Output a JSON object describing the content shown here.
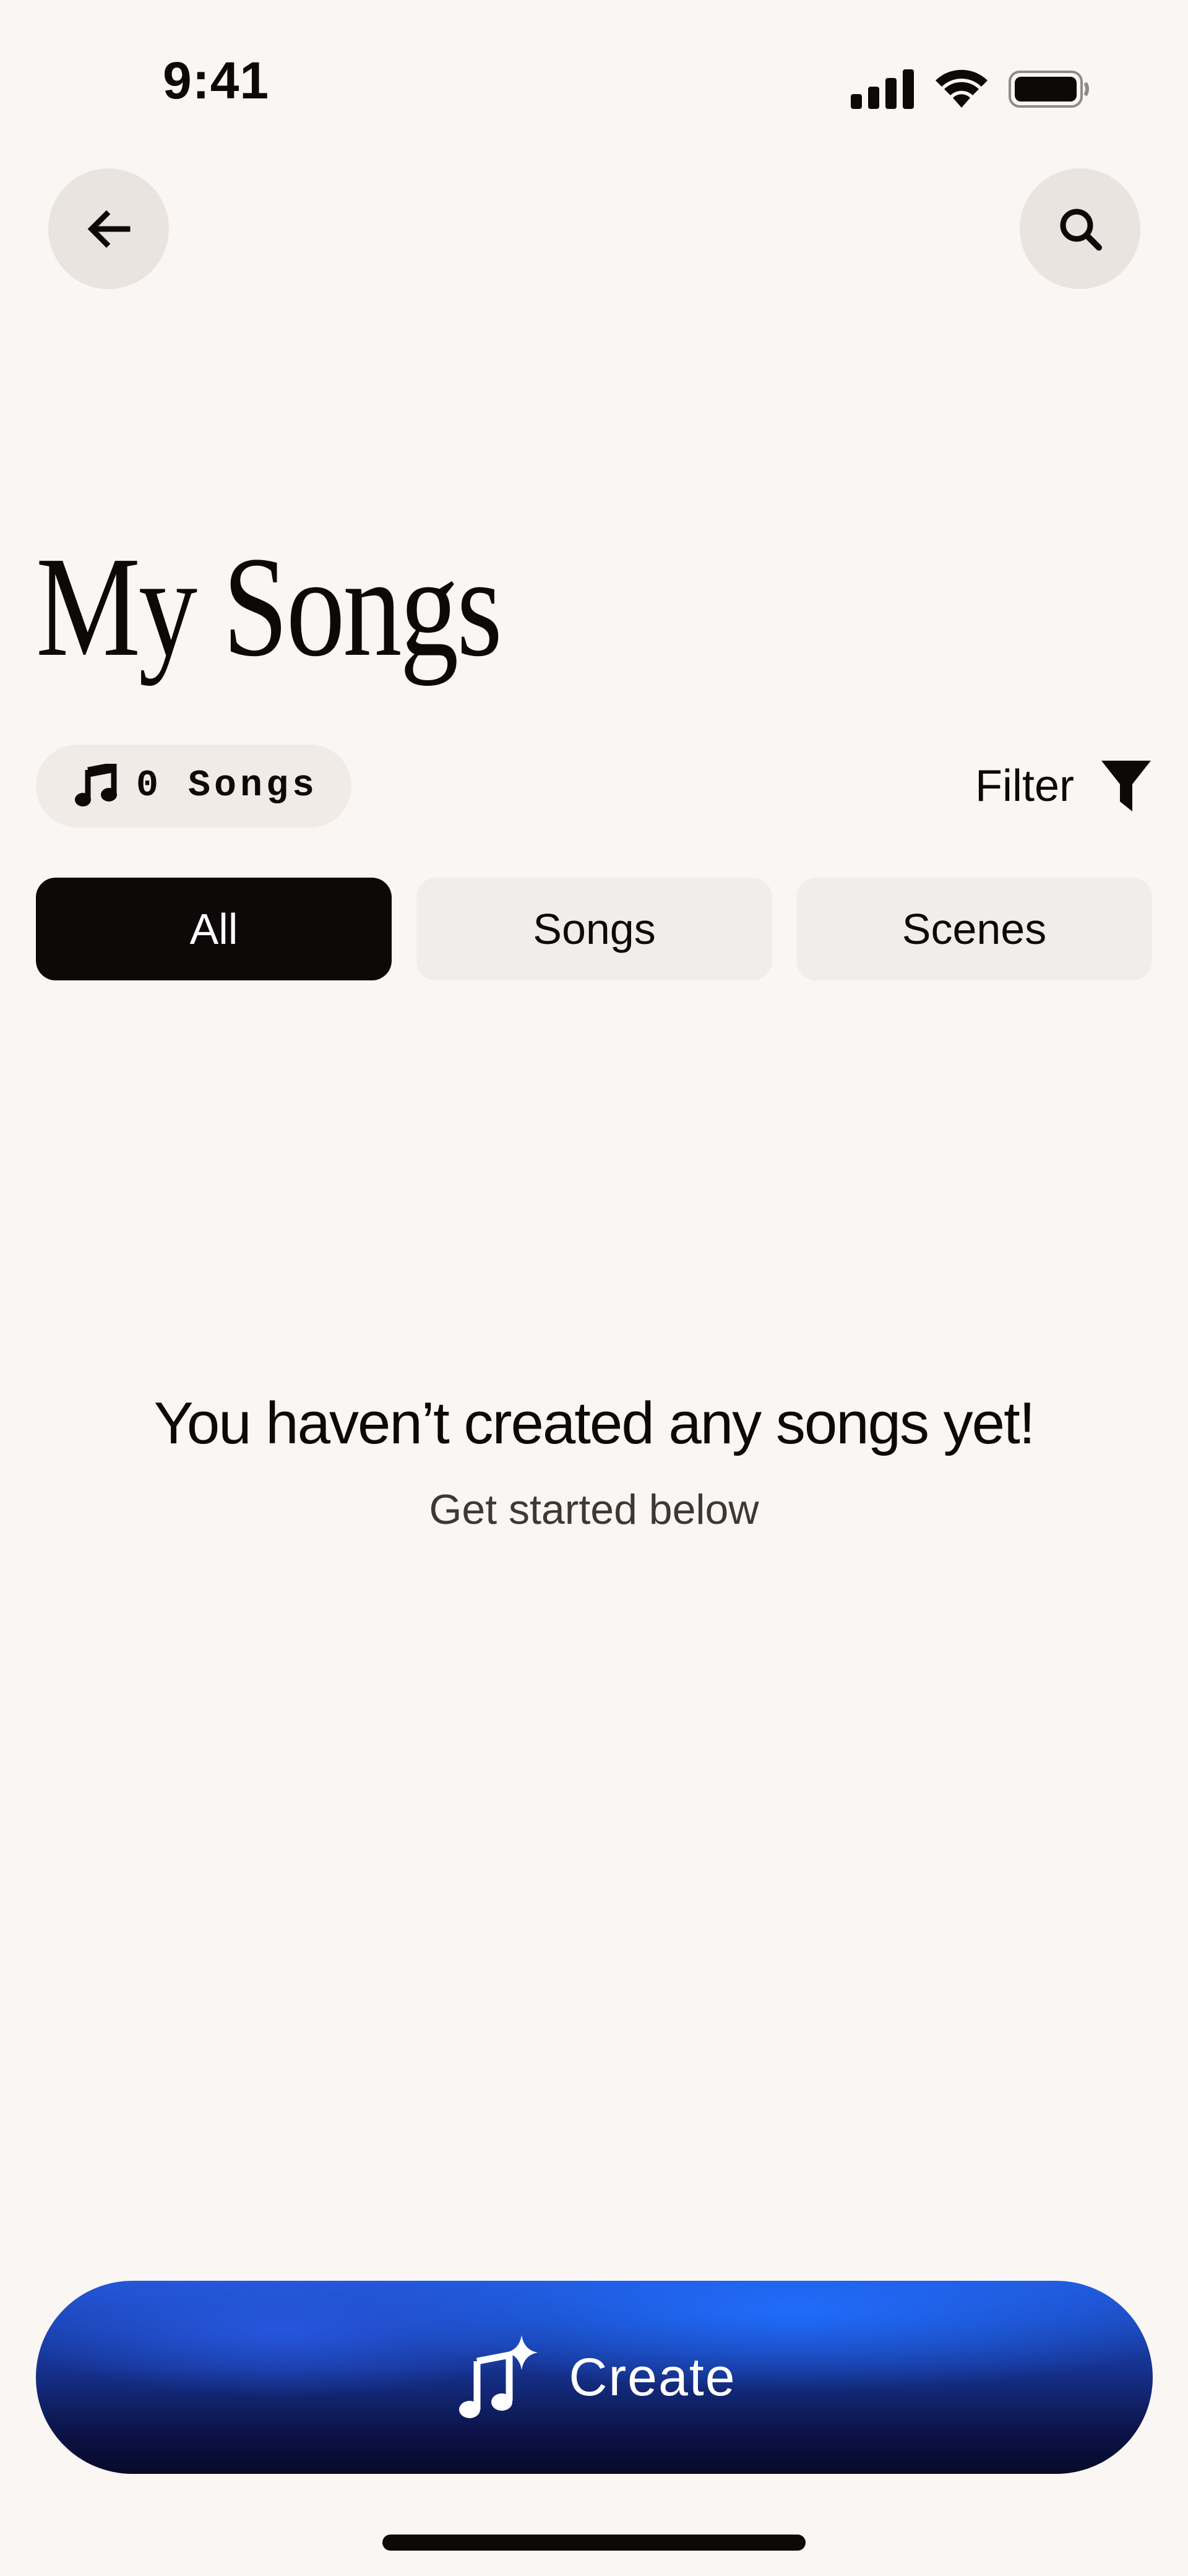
{
  "status_bar": {
    "time": "9:41",
    "icons": [
      "cellular-signal-icon",
      "wifi-icon",
      "battery-icon"
    ]
  },
  "header": {
    "back_icon": "arrow-left-icon",
    "search_icon": "search-icon"
  },
  "title": "My Songs",
  "song_count": {
    "icon": "music-note-icon",
    "label": "0 Songs"
  },
  "filter": {
    "label": "Filter",
    "icon": "funnel-icon"
  },
  "tabs": [
    {
      "label": "All",
      "selected": true
    },
    {
      "label": "Songs",
      "selected": false
    },
    {
      "label": "Scenes",
      "selected": false
    }
  ],
  "empty_state": {
    "title": "You haven’t created any songs yet!",
    "subtitle": "Get started below"
  },
  "create_button": {
    "icon": "music-sparkle-icon",
    "label": "Create"
  },
  "colors": {
    "background": "#f9f6f3",
    "primary": "#0d0908",
    "tab_inactive": "#f1edea",
    "create_blue": "#2257d8",
    "create_dark": "#070a2a"
  }
}
